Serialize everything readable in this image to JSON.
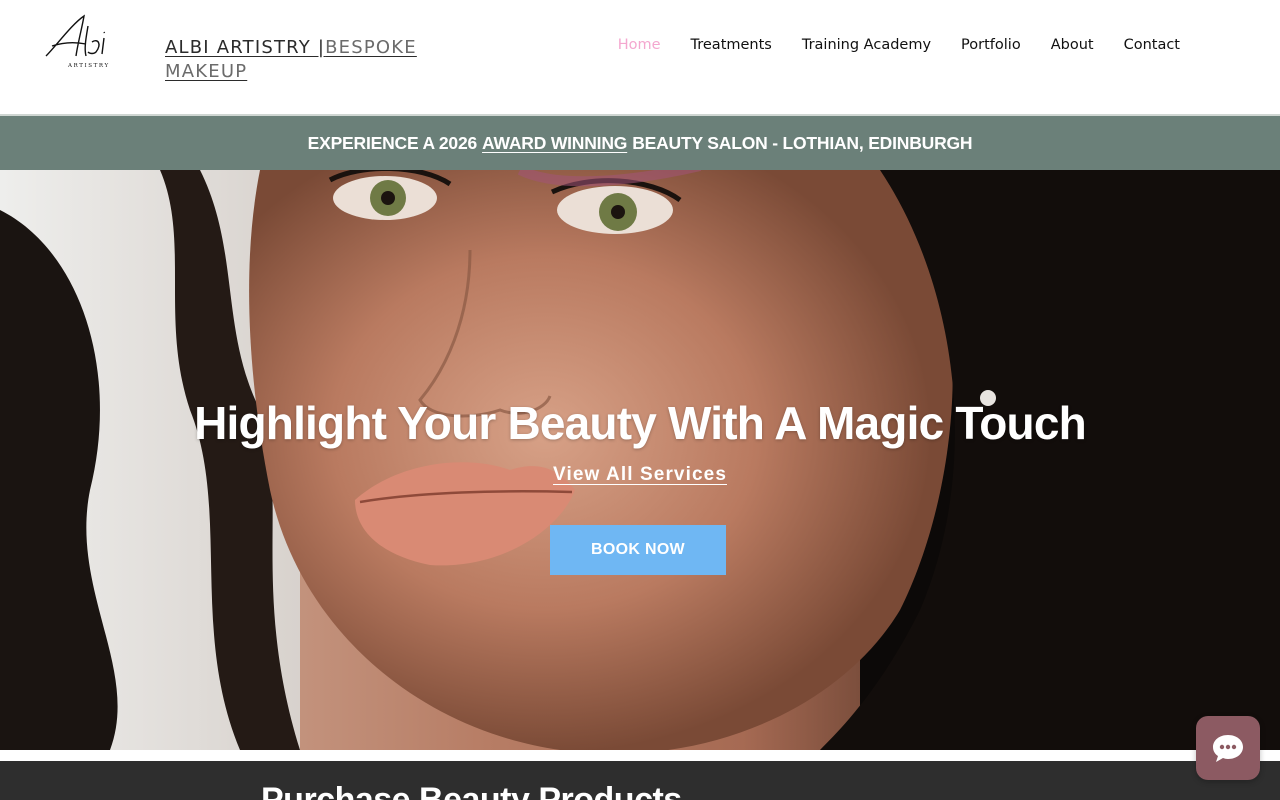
{
  "header": {
    "logo_text": "Albi",
    "logo_sub": "ARTISTRY",
    "brand_main": "ALBI ARTISTRY  |",
    "brand_sub": "BESPOKE MAKEUP",
    "nav": [
      {
        "label": "Home",
        "active": true
      },
      {
        "label": "Treatments",
        "active": false
      },
      {
        "label": "Training Academy",
        "active": false
      },
      {
        "label": "Portfolio",
        "active": false
      },
      {
        "label": "About",
        "active": false
      },
      {
        "label": "Contact",
        "active": false
      }
    ]
  },
  "banner": {
    "prefix": "EXPERIENCE A 2026",
    "link": "AWARD WINNING",
    "suffix": "BEAUTY SALON - LOTHIAN, EDINBURGH"
  },
  "hero": {
    "title": "Highlight Your Beauty With A Magic Touch",
    "link": "View All Services",
    "button": "BOOK NOW",
    "image_icon": "portrait-photo"
  },
  "section": {
    "title": "Purchase Beauty Products"
  },
  "chat": {
    "icon": "chat-bubble-icon"
  },
  "colors": {
    "nav_active": "#f4a7cf",
    "banner_bg": "#6b8079",
    "button_bg": "#6fb7f3",
    "chat_bg": "#8c5a62",
    "footer_bg": "#2e2e2e"
  }
}
